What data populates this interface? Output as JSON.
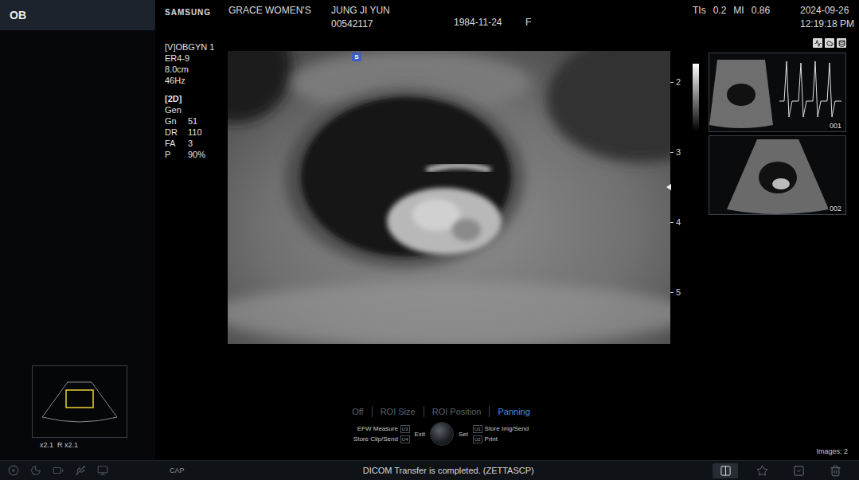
{
  "mode_tab": "OB",
  "header": {
    "brand": "SAMSUNG",
    "institution": "GRACE WOMEN'S",
    "patient_name": "JUNG JI YUN",
    "patient_id": "00542117",
    "birth_date": "1984-11-24",
    "sex": "F",
    "indices": [
      {
        "label": "TIs",
        "value": "0.2"
      },
      {
        "label": "MI",
        "value": "0.86"
      }
    ],
    "date": "2024-09-26",
    "time": "12:19:18 PM"
  },
  "probe": [
    "[V]OBGYN 1",
    "ER4-9",
    "8.0cm",
    "46Hz"
  ],
  "imaging_mode": "[2D]",
  "settings": [
    {
      "label": "Gen",
      "value": ""
    },
    {
      "label": "Gn",
      "value": "51"
    },
    {
      "label": "DR",
      "value": "110"
    },
    {
      "label": "FA",
      "value": "3"
    },
    {
      "label": "P",
      "value": "90%"
    }
  ],
  "image": {
    "orientation_marker": "S",
    "depth_ticks": [
      "2",
      "3",
      "4",
      "5"
    ]
  },
  "thumbnails": [
    {
      "label": "001",
      "kind": "doppler"
    },
    {
      "label": "002",
      "kind": "bmode"
    }
  ],
  "minimap": {
    "zoom": "x2.1  R x2.1"
  },
  "menu": [
    {
      "label": "Off",
      "selected": false
    },
    {
      "label": "ROI Size",
      "selected": false
    },
    {
      "label": "ROI Position",
      "selected": false
    },
    {
      "label": "Panning",
      "selected": true
    }
  ],
  "controls": {
    "left": [
      {
        "label": "EFW Measure",
        "key": "U3"
      },
      {
        "label": "Store Clip/Send",
        "key": "U4"
      }
    ],
    "exit": "Exit",
    "set": "Set",
    "right": [
      {
        "key": "U1",
        "label": "Store Img/Send"
      },
      {
        "key": "U2",
        "label": "Print"
      }
    ]
  },
  "image_count": "Images: 2",
  "status_bar": {
    "cap": "CAP",
    "message": "DICOM Transfer is completed. (ZETTASCP)",
    "tools": [
      {
        "kind": "dual",
        "selected": true
      },
      {
        "kind": "star",
        "selected": false
      },
      {
        "kind": "check",
        "selected": false
      },
      {
        "kind": "trash",
        "selected": false
      }
    ]
  }
}
